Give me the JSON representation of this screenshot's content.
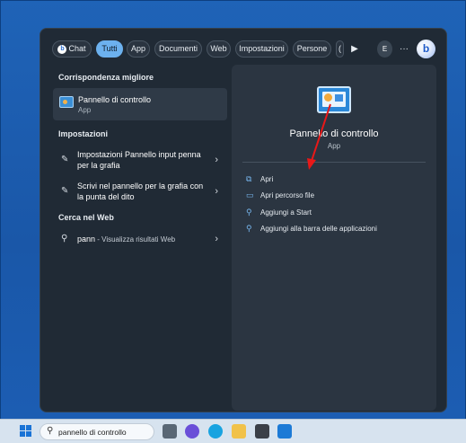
{
  "filters": {
    "chat": "Chat",
    "tutti": "Tutti",
    "app": "App",
    "documenti": "Documenti",
    "web": "Web",
    "impostazioni": "Impostazioni",
    "persone": "Persone",
    "partial": "(",
    "account_initial": "E",
    "more": "···"
  },
  "best_match": {
    "header": "Corrispondenza migliore",
    "title": "Pannello di controllo",
    "subtitle": "App"
  },
  "settings": {
    "header": "Impostazioni",
    "items": [
      {
        "line1": "Impostazioni Pannello input penna",
        "line2": "per la grafia"
      },
      {
        "line1": "Scrivi nel pannello per la grafia con",
        "line2": "la punta del dito"
      }
    ]
  },
  "web": {
    "header": "Cerca nel Web",
    "query": "pann",
    "suffix": " - Visualizza risultati Web"
  },
  "detail": {
    "title": "Pannello di controllo",
    "subtitle": "App",
    "actions": [
      {
        "label": "Apri",
        "icon": "open-external-icon"
      },
      {
        "label": "Apri percorso file",
        "icon": "folder-icon"
      },
      {
        "label": "Aggiungi a Start",
        "icon": "pin-icon"
      },
      {
        "label": "Aggiungi alla barra delle applicazioni",
        "icon": "pin-icon"
      }
    ]
  },
  "taskbar": {
    "search_value": "pannello di controllo"
  },
  "colors": {
    "accent": "#6cb1ee",
    "annotation_arrow": "#e81818",
    "panel_bg": "#202a35",
    "detail_bg": "#2b3541"
  }
}
